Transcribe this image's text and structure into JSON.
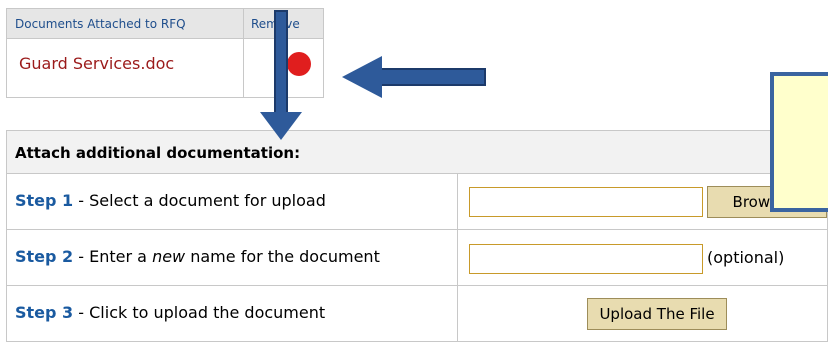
{
  "attached": {
    "header_docs": "Documents Attached to RFQ",
    "header_remove": "Remove",
    "files": [
      {
        "name": "Guard Services.doc"
      }
    ]
  },
  "form": {
    "title": "Attach additional documentation:",
    "step1": {
      "num": "Step 1",
      "text": " - Select a document for upload"
    },
    "step2": {
      "num": "Step 2",
      "text_before": " - Enter a ",
      "text_em": "new",
      "text_after": " name for the document"
    },
    "step3": {
      "num": "Step 3",
      "text": " - Click to upload the document"
    },
    "browse_label": "Browse...",
    "optional_label": "(optional)",
    "upload_label": "Upload The File"
  },
  "colors": {
    "accent": "#1a5aa0",
    "file_link": "#9b1a1a",
    "arrow": "#2e5a9a",
    "note_bg": "#ffffcc"
  }
}
